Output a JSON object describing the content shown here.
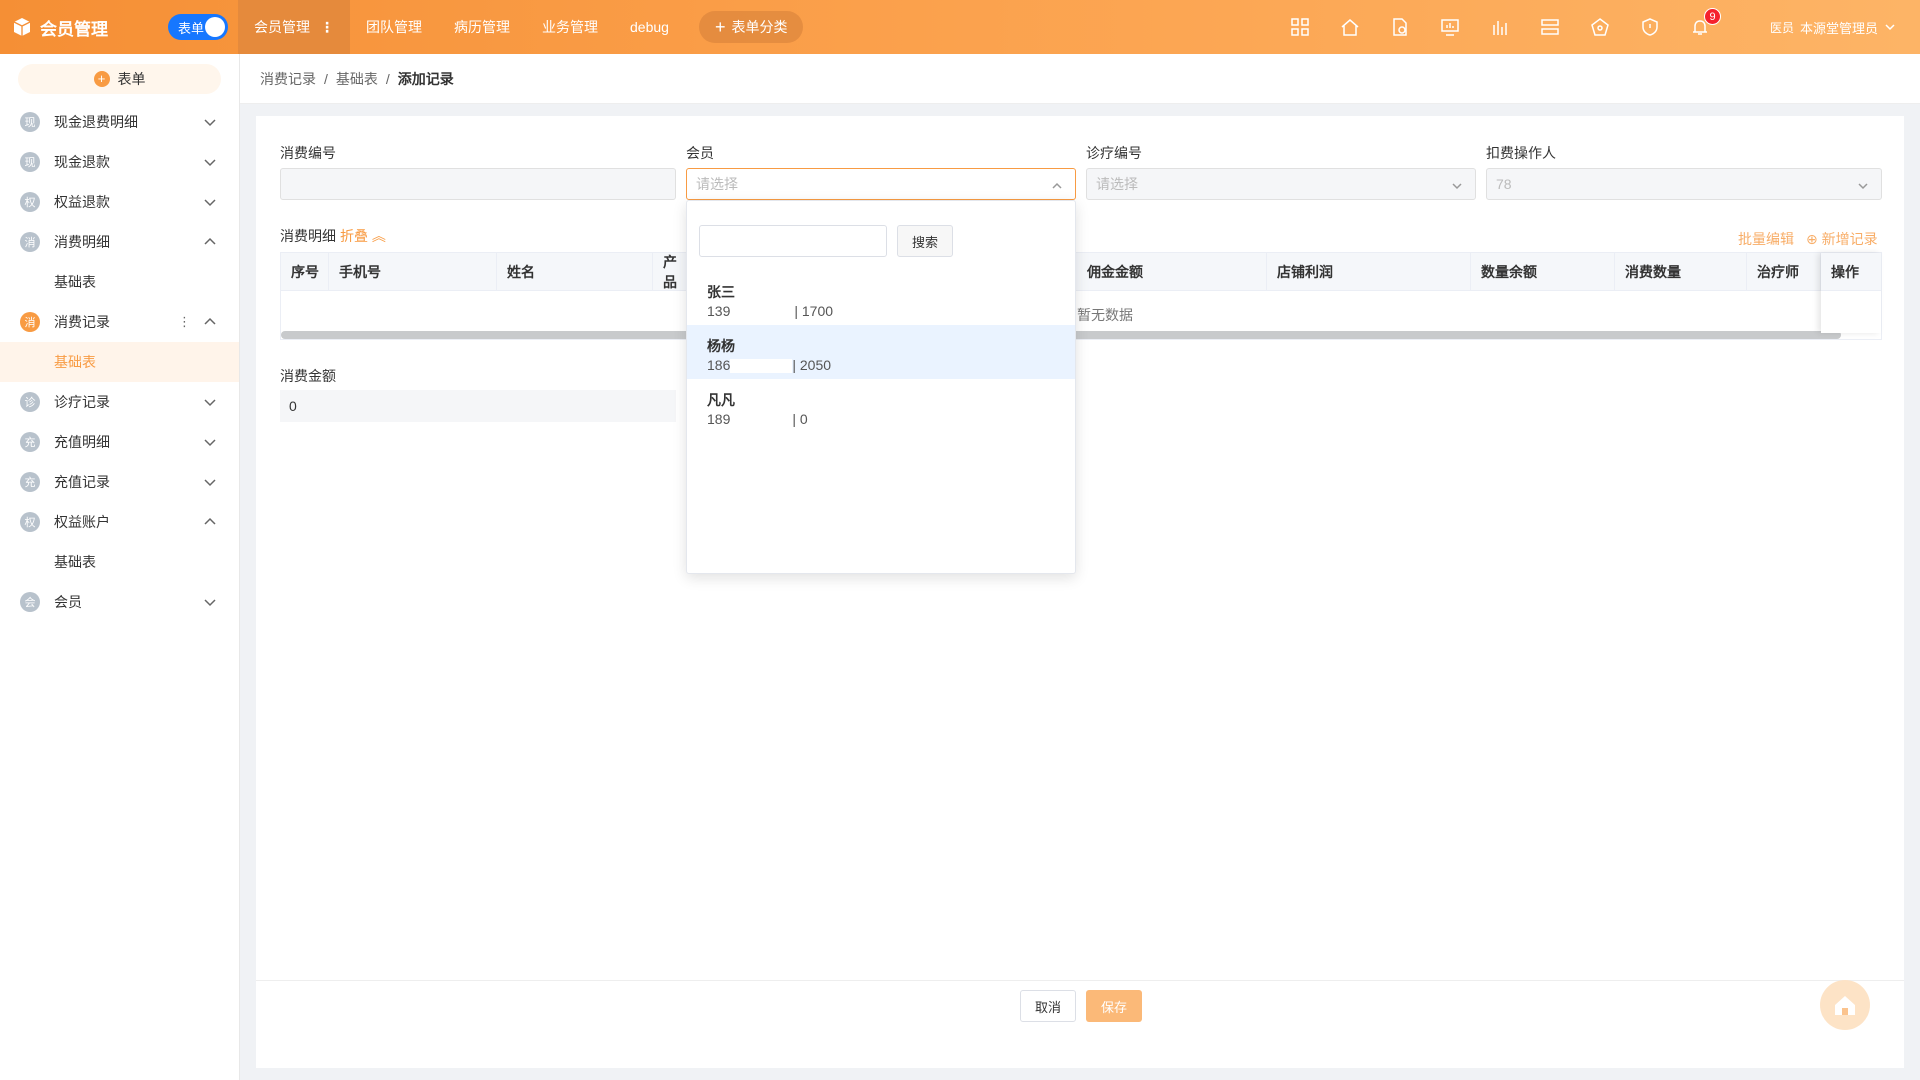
{
  "app": {
    "title": "会员管理",
    "toggle_label": "表单"
  },
  "nav": {
    "items": [
      "会员管理",
      "团队管理",
      "病历管理",
      "业务管理",
      "debug"
    ],
    "category_button": "表单分类"
  },
  "notifications": {
    "count": "9"
  },
  "user": {
    "name": "本源堂管理员",
    "role": "医员"
  },
  "sidebar": {
    "form_button": "表单",
    "items": [
      {
        "icon": "现",
        "label": "现金退费明细"
      },
      {
        "icon": "现",
        "label": "现金退款"
      },
      {
        "icon": "权",
        "label": "权益退款"
      },
      {
        "icon": "消",
        "label": "消费明细",
        "sub": "基础表"
      },
      {
        "icon": "消",
        "label": "消费记录",
        "sub": "基础表"
      },
      {
        "icon": "诊",
        "label": "诊疗记录"
      },
      {
        "icon": "充",
        "label": "充值明细"
      },
      {
        "icon": "充",
        "label": "充值记录"
      },
      {
        "icon": "权",
        "label": "权益账户",
        "sub": "基础表"
      },
      {
        "icon": "会",
        "label": "会员"
      }
    ]
  },
  "breadcrumb": [
    "消费记录",
    "基础表",
    "添加记录"
  ],
  "form": {
    "consume_no": {
      "label": "消费编号",
      "value": ""
    },
    "member": {
      "label": "会员",
      "placeholder": "请选择"
    },
    "treatment_no": {
      "label": "诊疗编号",
      "placeholder": "请选择"
    },
    "operator": {
      "label": "扣费操作人",
      "value": "78"
    },
    "detail_label": "消费明细",
    "fold_label": "折叠",
    "batch_edit": "批量编辑",
    "add_record": "新增记录",
    "amount_label": "消费金额",
    "amount_value": "0"
  },
  "table": {
    "headers": [
      "序号",
      "手机号",
      "姓名",
      "产品",
      "佣金金额",
      "店铺利润",
      "数量余额",
      "消费数量",
      "治疗师",
      "操作"
    ],
    "empty_text": "暂无数据"
  },
  "dropdown": {
    "search_button": "搜索",
    "options": [
      {
        "name": "张三",
        "phone": "139",
        "balance": "| 1700"
      },
      {
        "name": "杨杨",
        "phone": "186",
        "balance": "| 2050"
      },
      {
        "name": "凡凡",
        "phone": "189",
        "balance": "| 0"
      }
    ]
  },
  "footer": {
    "cancel": "取消",
    "save": "保存"
  },
  "colors": {
    "brand": "#f89b43",
    "toggle": "#1677ff"
  }
}
